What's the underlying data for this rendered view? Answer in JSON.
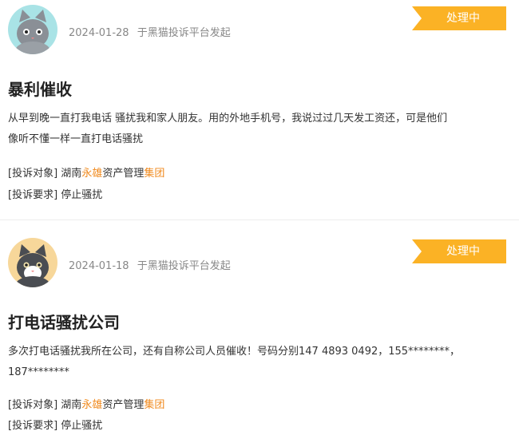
{
  "complaints": [
    {
      "date": "2024-01-28",
      "source": "于黑猫投诉平台发起",
      "status": "处理中",
      "title": "暴利催收",
      "body_line1": "从早到晚一直打我电话 骚扰我和家人朋友。用的外地手机号，我说过过几天发工资还，可是他们",
      "body_line2": "像听不懂一样一直打电话骚扰",
      "target_label": "[投诉对象]",
      "target_parts": [
        "湖南",
        "永雄",
        "资产管理",
        "集团"
      ],
      "demand_label": "[投诉要求]",
      "demand_value": "停止骚扰",
      "avatar": "gray-cat-avatar-icon"
    },
    {
      "date": "2024-01-18",
      "source": "于黑猫投诉平台发起",
      "status": "处理中",
      "title": "打电话骚扰公司",
      "body_line1": "多次打电话骚扰我所在公司，还有自称公司人员催收！号码分别147 4893 0492，155********，",
      "body_line2": "187********",
      "target_label": "[投诉对象]",
      "target_parts": [
        "湖南",
        "永雄",
        "资产管理",
        "集团"
      ],
      "demand_label": "[投诉要求]",
      "demand_value": "停止骚扰",
      "avatar": "tuxedo-cat-avatar-icon"
    }
  ],
  "colors": {
    "badge": "#fbb225",
    "highlight": "#f08a1e"
  }
}
